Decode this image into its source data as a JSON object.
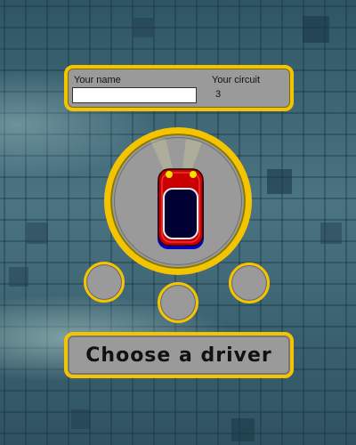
{
  "info_panel": {
    "name_label": "Your name",
    "name_value": "",
    "circuit_label": "Your circuit",
    "circuit_value": "3"
  },
  "car": {
    "icon": "red-car-icon",
    "body_color": "#cc0000",
    "underbody_color": "#0000cc",
    "window_color": "#000033",
    "headlight_color": "#f5e000"
  },
  "driver_options": [
    "driver-option-1",
    "driver-option-2",
    "driver-option-3"
  ],
  "choose_button": {
    "label": "Choose a driver"
  },
  "colors": {
    "accent": "#f5c400",
    "panel": "#9a9a9a",
    "background": "#3d6473"
  }
}
